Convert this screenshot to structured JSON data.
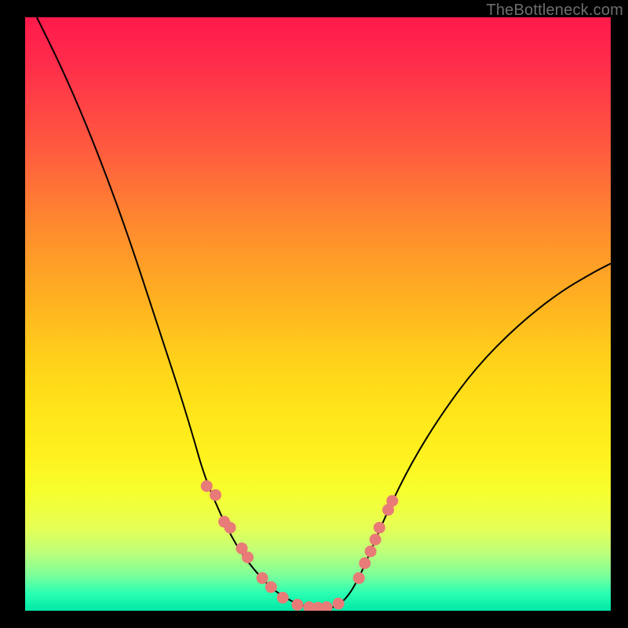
{
  "watermark": "TheBottleneck.com",
  "colors": {
    "dot": "#e87b77",
    "curve": "#000000",
    "frame": "#000000"
  },
  "chart_data": {
    "type": "line",
    "title": "",
    "xlabel": "",
    "ylabel": "",
    "xlim": [
      0,
      100
    ],
    "ylim": [
      0,
      100
    ],
    "grid": false,
    "curve_points": [
      {
        "x": 2,
        "y": 100
      },
      {
        "x": 6,
        "y": 92
      },
      {
        "x": 10,
        "y": 83
      },
      {
        "x": 14,
        "y": 73
      },
      {
        "x": 18,
        "y": 62
      },
      {
        "x": 22,
        "y": 50
      },
      {
        "x": 26,
        "y": 38
      },
      {
        "x": 28.5,
        "y": 30
      },
      {
        "x": 30.5,
        "y": 23
      },
      {
        "x": 33,
        "y": 17
      },
      {
        "x": 36,
        "y": 11
      },
      {
        "x": 39,
        "y": 7
      },
      {
        "x": 42,
        "y": 3.8
      },
      {
        "x": 45,
        "y": 1.8
      },
      {
        "x": 48,
        "y": 0.6
      },
      {
        "x": 51,
        "y": 0.3
      },
      {
        "x": 53,
        "y": 0.6
      },
      {
        "x": 55,
        "y": 2.2
      },
      {
        "x": 57,
        "y": 5.5
      },
      {
        "x": 59,
        "y": 10
      },
      {
        "x": 62,
        "y": 17
      },
      {
        "x": 66,
        "y": 25
      },
      {
        "x": 71,
        "y": 33
      },
      {
        "x": 77,
        "y": 41
      },
      {
        "x": 84,
        "y": 48
      },
      {
        "x": 91,
        "y": 53.5
      },
      {
        "x": 97,
        "y": 57
      },
      {
        "x": 100,
        "y": 58.5
      }
    ],
    "marker_points": [
      {
        "x": 31,
        "y": 21
      },
      {
        "x": 32.5,
        "y": 19.5
      },
      {
        "x": 34,
        "y": 15
      },
      {
        "x": 35,
        "y": 14
      },
      {
        "x": 37,
        "y": 10.5
      },
      {
        "x": 38,
        "y": 9
      },
      {
        "x": 40.5,
        "y": 5.5
      },
      {
        "x": 42,
        "y": 4
      },
      {
        "x": 44,
        "y": 2.2
      },
      {
        "x": 46.5,
        "y": 1
      },
      {
        "x": 48.5,
        "y": 0.6
      },
      {
        "x": 50,
        "y": 0.5
      },
      {
        "x": 51.5,
        "y": 0.6
      },
      {
        "x": 53.5,
        "y": 1.2
      },
      {
        "x": 57,
        "y": 5.5
      },
      {
        "x": 58,
        "y": 8
      },
      {
        "x": 59,
        "y": 10
      },
      {
        "x": 59.8,
        "y": 12
      },
      {
        "x": 60.5,
        "y": 14
      },
      {
        "x": 62,
        "y": 17
      },
      {
        "x": 62.7,
        "y": 18.5
      }
    ]
  }
}
